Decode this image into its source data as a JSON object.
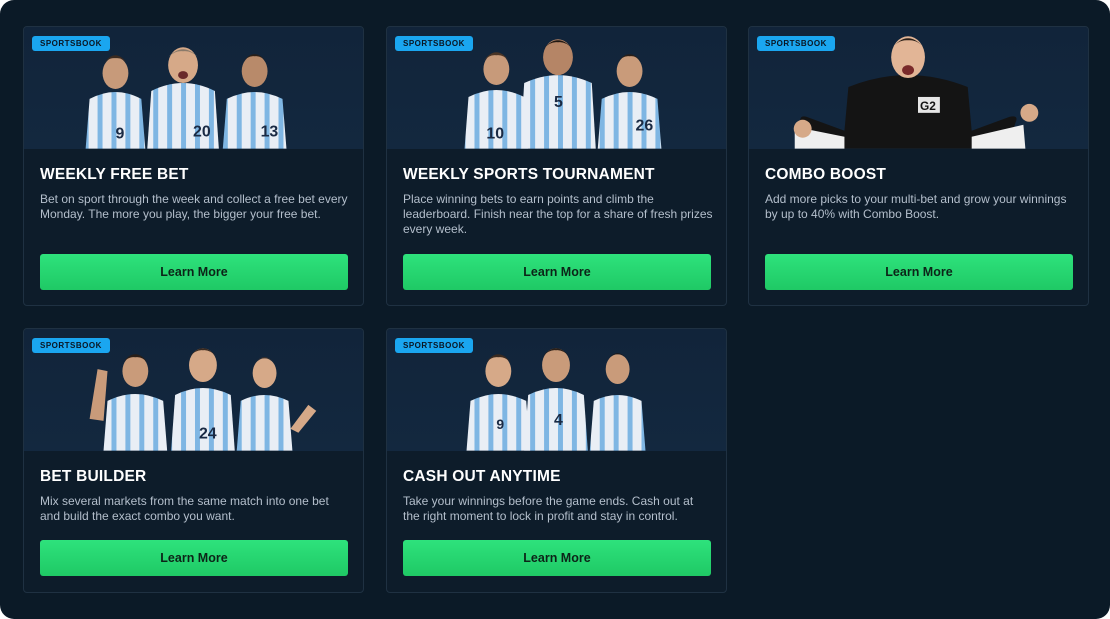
{
  "promotions": [
    {
      "badge": "SPORTSBOOK",
      "title": "WEEKLY FREE BET",
      "description": "Bet on sport through the week and collect a free bet every Monday. The more you play, the bigger your free bet.",
      "button": "Learn More",
      "image": "argentina-players-photo"
    },
    {
      "badge": "SPORTSBOOK",
      "title": "WEEKLY SPORTS TOURNAMENT",
      "description": "Place winning bets to earn points and climb the leaderboard. Finish near the top for a share of fresh prizes every week.",
      "button": "Learn More",
      "image": "argentina-players-photo"
    },
    {
      "badge": "SPORTSBOOK",
      "title": "COMBO BOOST",
      "description": "Add more picks to your multi-bet and grow your winnings by up to 40% with Combo Boost.",
      "button": "Learn More",
      "image": "celebrating-fan-photo"
    },
    {
      "badge": "SPORTSBOOK",
      "title": "BET BUILDER",
      "description": "Mix several markets from the same match into one bet and build the exact combo you want.",
      "button": "Learn More",
      "image": "argentina-players-photo"
    },
    {
      "badge": "SPORTSBOOK",
      "title": "CASH OUT ANYTIME",
      "description": "Take your winnings before the game ends. Cash out at the right moment to lock in profit and stay in control.",
      "button": "Learn More",
      "image": "argentina-players-photo"
    }
  ],
  "colors": {
    "background": "#0b1a27",
    "card": "#0d1c2a",
    "badge": "#1aa6f0",
    "button": "#2ee27c",
    "title": "#ffffff",
    "description": "#b4bfcc"
  }
}
